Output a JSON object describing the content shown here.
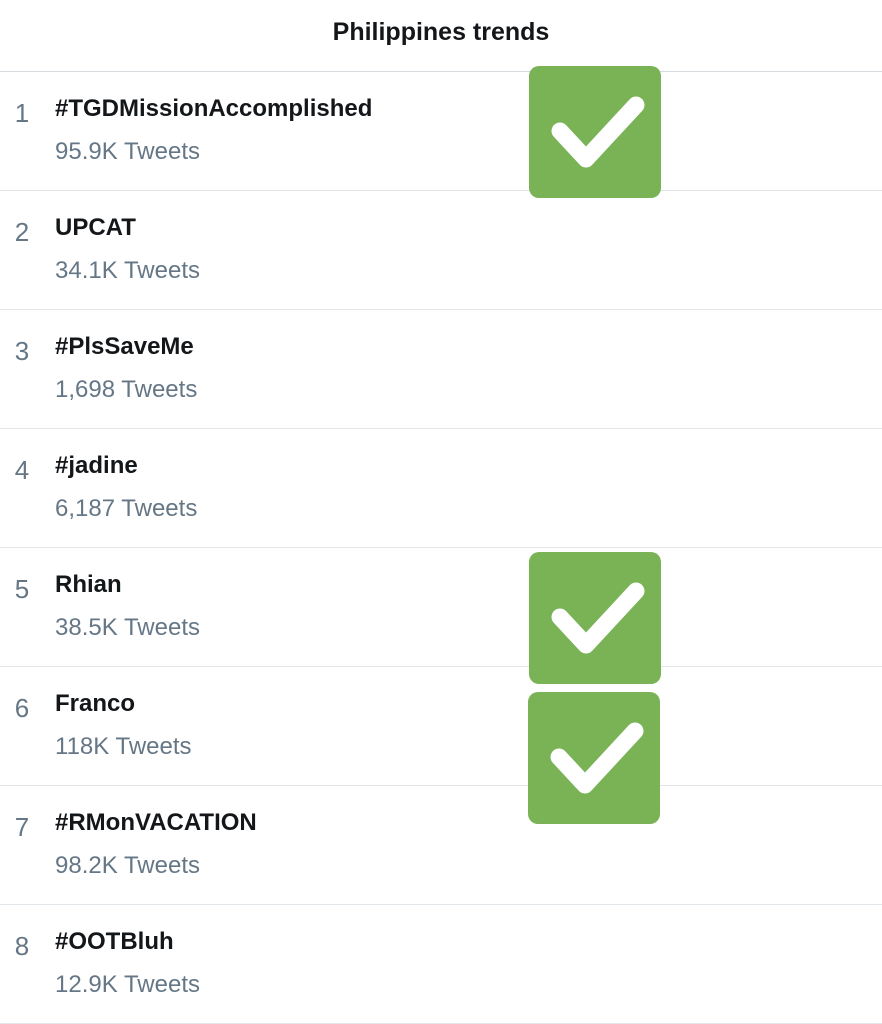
{
  "header": {
    "title": "Philippines trends"
  },
  "trends": [
    {
      "rank": "1",
      "name": "#TGDMissionAccomplished",
      "count": "95.9K Tweets",
      "checked": true
    },
    {
      "rank": "2",
      "name": "UPCAT",
      "count": "34.1K Tweets",
      "checked": false
    },
    {
      "rank": "3",
      "name": "#PlsSaveMe",
      "count": "1,698 Tweets",
      "checked": false
    },
    {
      "rank": "4",
      "name": "#jadine",
      "count": "6,187 Tweets",
      "checked": false
    },
    {
      "rank": "5",
      "name": "Rhian",
      "count": "38.5K Tweets",
      "checked": true
    },
    {
      "rank": "6",
      "name": "Franco",
      "count": "118K Tweets",
      "checked": true
    },
    {
      "rank": "7",
      "name": "#RMonVACATION",
      "count": "98.2K Tweets",
      "checked": false
    },
    {
      "rank": "8",
      "name": "#OOTBluh",
      "count": "12.9K Tweets",
      "checked": false
    }
  ],
  "check_badge": {
    "icon": "checkmark-icon",
    "background_color": "#79b356",
    "mark_color": "#ffffff"
  }
}
